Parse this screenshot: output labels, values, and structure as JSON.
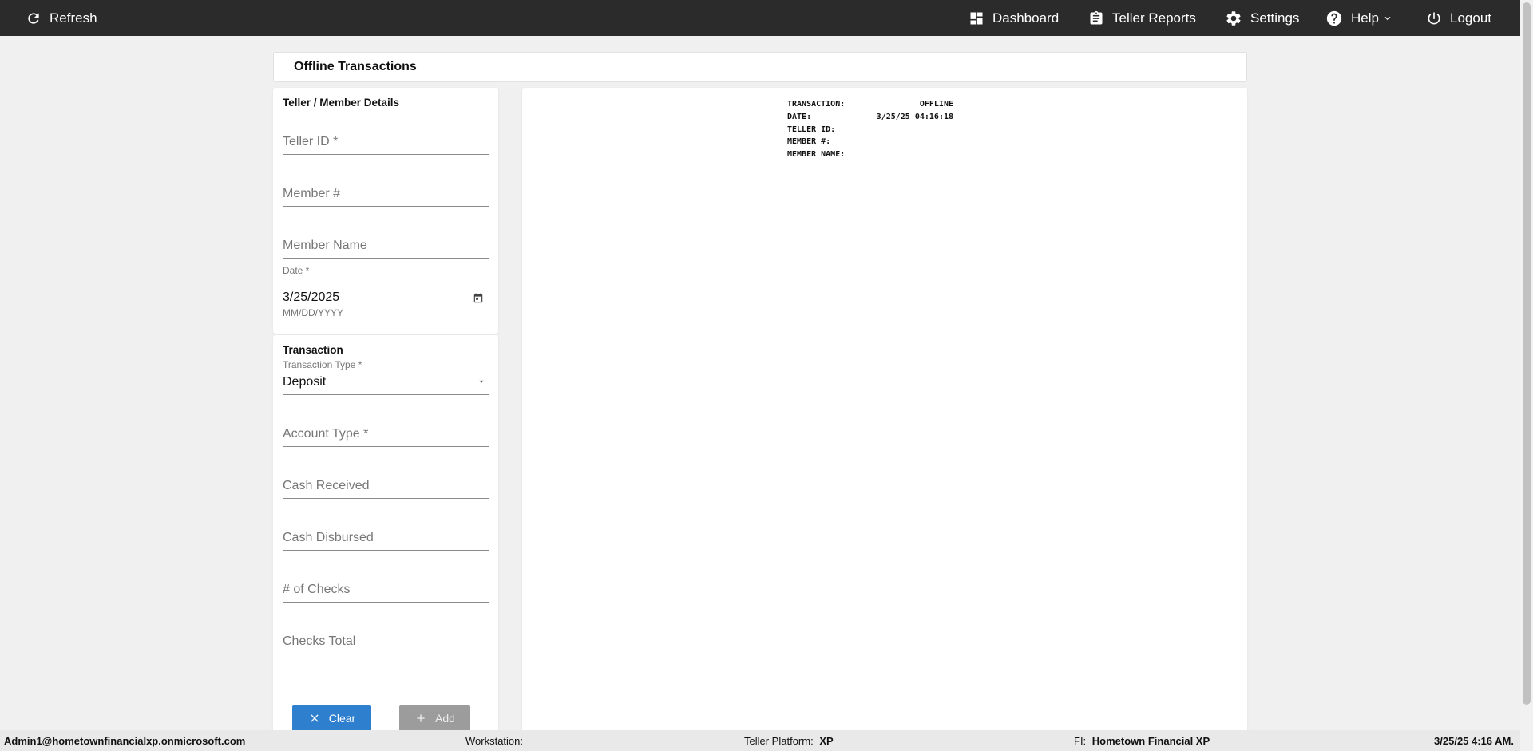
{
  "topbar": {
    "refresh_label": "Refresh",
    "nav": {
      "dashboard": "Dashboard",
      "teller_reports": "Teller Reports",
      "settings": "Settings",
      "help": "Help",
      "logout": "Logout"
    }
  },
  "page": {
    "title": "Offline Transactions"
  },
  "member_section": {
    "title": "Teller / Member Details",
    "teller_id_placeholder": "Teller ID *",
    "member_number_placeholder": "Member #",
    "member_name_placeholder": "Member Name",
    "date_label": "Date *",
    "date_value": "3/25/2025",
    "date_hint": "MM/DD/YYYY"
  },
  "transaction_section": {
    "title": "Transaction",
    "type_label": "Transaction Type *",
    "type_value": "Deposit",
    "account_type_placeholder": "Account Type *",
    "cash_received_placeholder": "Cash Received",
    "cash_disbursed_placeholder": "Cash Disbursed",
    "num_checks_placeholder": "# of Checks",
    "checks_total_placeholder": "Checks Total"
  },
  "buttons": {
    "clear": "Clear",
    "add": "Add"
  },
  "receipt": {
    "rows": [
      {
        "key": "TRANSACTION:",
        "value": "OFFLINE"
      },
      {
        "key": "DATE:",
        "value": "3/25/25 04:16:18"
      },
      {
        "key": "TELLER ID:",
        "value": ""
      },
      {
        "key": "MEMBER #:",
        "value": ""
      },
      {
        "key": "MEMBER NAME:",
        "value": ""
      }
    ]
  },
  "status": {
    "user": "Admin1@hometownfinancialxp.onmicrosoft.com",
    "workstation_label": "Workstation:",
    "workstation_value": "",
    "platform_label": "Teller Platform:",
    "platform_value": "XP",
    "fi_label": "FI:",
    "fi_value": "Hometown Financial XP",
    "datetime": "3/25/25 4:16 AM."
  },
  "icons": {
    "refresh": "refresh-icon",
    "dashboard": "dashboard-icon",
    "reports": "clipboard-icon",
    "settings": "gear-icon",
    "help": "help-circle-icon",
    "logout": "power-icon",
    "calendar": "calendar-icon",
    "dropdown": "caret-down-icon",
    "clear": "close-icon",
    "add": "plus-icon"
  }
}
